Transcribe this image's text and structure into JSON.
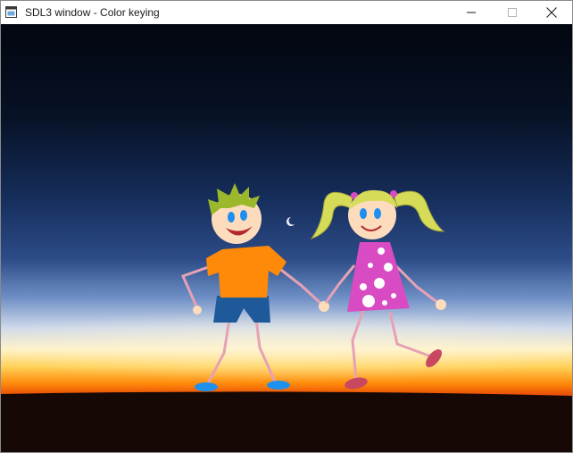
{
  "window": {
    "title": "SDL3 window - Color keying",
    "icon": "sdl-app-icon",
    "controls": [
      "minimize-icon",
      "maximize-icon",
      "close-icon"
    ]
  },
  "scene": {
    "background": "sunset-horizon-photo",
    "sprite": "stick-figure-boy-and-girl-holding-hands",
    "colors": {
      "sky_top": "#040814",
      "sky_mid": "#2d4c88",
      "horizon_glow": "#ff8a0a",
      "ground": "#140805",
      "boy_shirt": "#ff8a0a",
      "boy_shorts": "#1e5a9a",
      "boy_hair": "#9ab82a",
      "girl_dress": "#d94bc2",
      "girl_hair": "#d6dc58",
      "skin": "#fcdcbc",
      "limbs": "#e6a2b4",
      "boy_shoes": "#1e90ee",
      "girl_shoes": "#c84862",
      "eyes": "#1e8ef0"
    }
  }
}
